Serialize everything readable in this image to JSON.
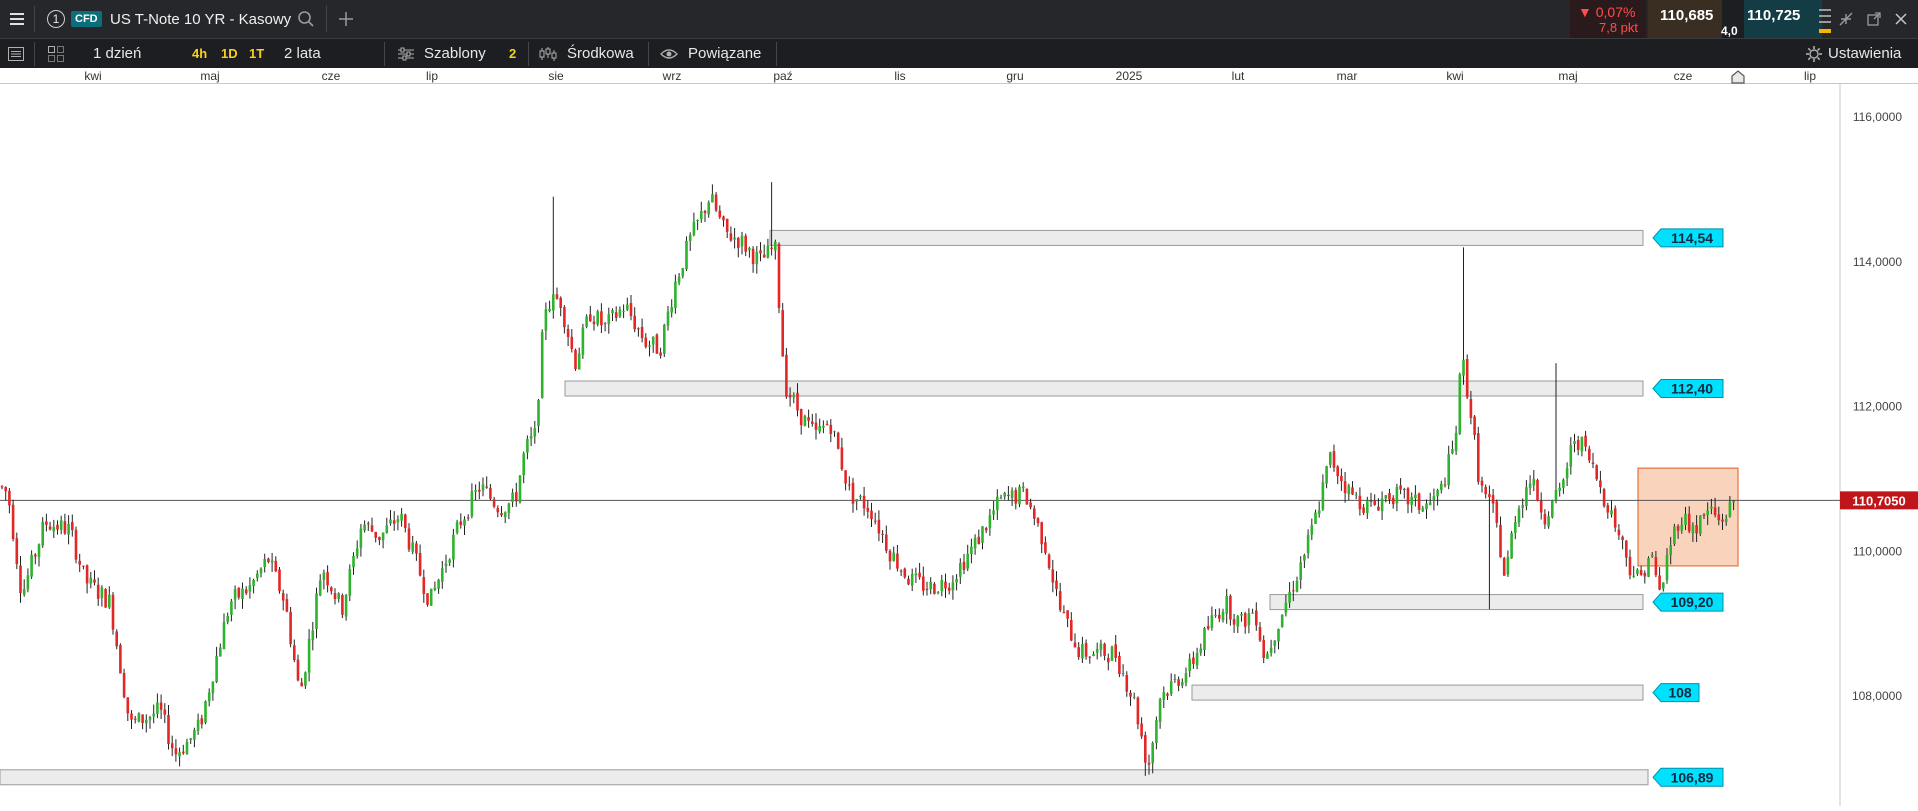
{
  "header": {
    "layout_number": "1",
    "badge": "CFD",
    "instrument": "US T-Note 10 YR - Kasowy",
    "change_pct": "0,07%",
    "change_pts": "7,8 pkt",
    "bid": "110,685",
    "ask": "110,725",
    "spread": "4,0"
  },
  "toolbar": {
    "interval": "1 dzień",
    "quick_intervals": [
      "4h",
      "1D",
      "1T"
    ],
    "range": "2 lata",
    "templates": "Szablony",
    "templates_count": "2",
    "indicator": "Środkowa",
    "linked": "Powiązane",
    "settings": "Ustawienia"
  },
  "x_axis_labels": [
    "kwi",
    "maj",
    "cze",
    "lip",
    "sie",
    "wrz",
    "paź",
    "lis",
    "gru",
    "2025",
    "lut",
    "mar",
    "kwi",
    "maj",
    "cze",
    "lip"
  ],
  "chart_data": {
    "type": "candlestick",
    "y_ticks": [
      "116,0000",
      "114,0000",
      "112,0000",
      "110,0000",
      "108,0000"
    ],
    "ylim": [
      106.6,
      116.3
    ],
    "current_price": "110,7050",
    "levels": [
      {
        "label": "114,54",
        "value": 114.33
      },
      {
        "label": "112,40",
        "value": 112.25
      },
      {
        "label": "109,20",
        "value": 109.3
      },
      {
        "label": "108",
        "value": 108.05
      },
      {
        "label": "106,89",
        "value": 106.88
      }
    ],
    "colors": {
      "up": "#2db32d",
      "down": "#e32626",
      "zone": "#f8cbb0",
      "zone_border": "#e8733a",
      "level_tag": "#00e1ff",
      "price_tag": "#c0161b"
    }
  }
}
